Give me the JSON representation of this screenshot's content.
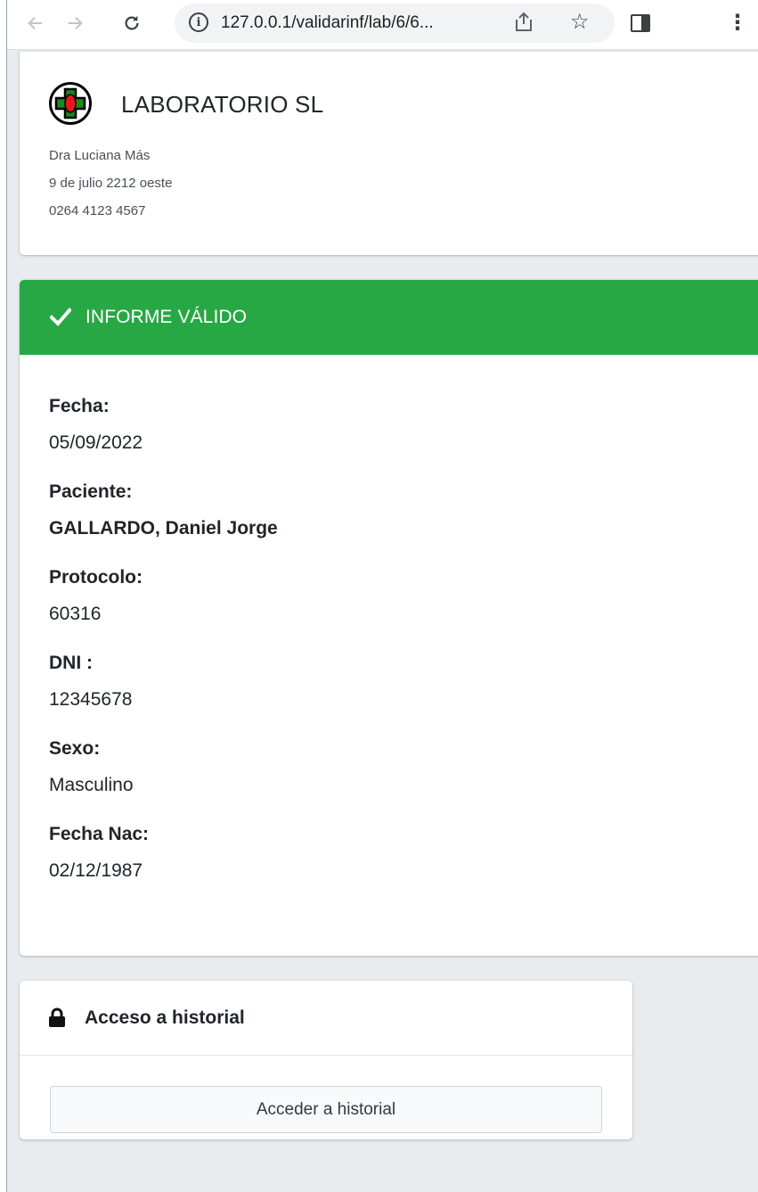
{
  "browser": {
    "url": "127.0.0.1/validarinf/lab/6/6...",
    "icons": [
      "back-arrow-icon",
      "forward-arrow-icon",
      "reload-icon",
      "info-icon",
      "share-icon",
      "star-icon",
      "side-panel-icon",
      "menu-icon"
    ]
  },
  "lab": {
    "name": "LABORATORIO SL",
    "doctor": "Dra Luciana Más",
    "address": "9 de julio 2212 oeste",
    "phone": "0264 4123 4567"
  },
  "informe": {
    "status": "INFORME VÁLIDO",
    "status_color": "#28a745",
    "fields": [
      {
        "label": "Fecha:",
        "value": "05/09/2022"
      },
      {
        "label": "Paciente:",
        "value": "GALLARDO, Daniel Jorge"
      },
      {
        "label": "Protocolo:",
        "value": "60316"
      },
      {
        "label": "DNI :",
        "value": "12345678"
      },
      {
        "label": "Sexo:",
        "value": "Masculino"
      },
      {
        "label": "Fecha Nac:",
        "value": "02/12/1987"
      }
    ]
  },
  "historial": {
    "title": "Acceso a historial",
    "button_label": "Acceder a historial"
  }
}
